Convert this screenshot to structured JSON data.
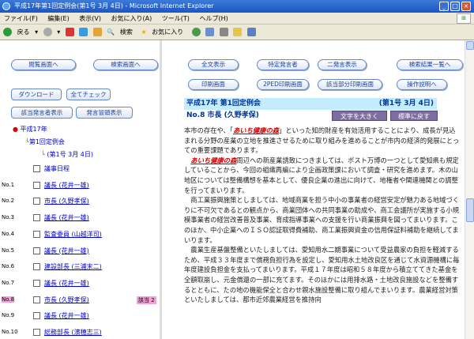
{
  "window": {
    "title": "平成17年第1回定例会(第1号 3月 4日) - Microsoft Internet Explorer"
  },
  "menu": [
    "ファイル(F)",
    "編集(E)",
    "表示(V)",
    "お気に入り(A)",
    "ツール(T)",
    "ヘルプ(H)"
  ],
  "toolbar": {
    "back": "戻る",
    "search": "検索",
    "favorites": "お気に入り"
  },
  "left": {
    "nav_buttons": [
      "閲覧画面へ",
      "検索画面へ"
    ],
    "action_buttons": [
      "ダウンロード",
      "全てチェック",
      "該当発言者表示",
      "発言冒頭表示"
    ],
    "tree": {
      "level1": "平成17年",
      "level2": "第1回定例会",
      "level3": "(第1号 3月 4日)"
    },
    "rows": [
      {
        "no": "",
        "label": "議事日程",
        "topic": ""
      },
      {
        "no": "No.1",
        "label": "議長 (花井一雄)",
        "topic": ""
      },
      {
        "no": "No.2",
        "label": "市長 (久野孝保)",
        "topic": ""
      },
      {
        "no": "No.3",
        "label": "議長 (花井一雄)",
        "topic": ""
      },
      {
        "no": "No.4",
        "label": "監査委員 (山越洋司)",
        "topic": ""
      },
      {
        "no": "No.5",
        "label": "議長 (花井一雄)",
        "topic": ""
      },
      {
        "no": "No.6",
        "label": "建設部長 (三浦末二)",
        "topic": ""
      },
      {
        "no": "No.7",
        "label": "議長 (花井一雄)",
        "topic": ""
      },
      {
        "no": "No.8",
        "label": "市長 (久野孝保)",
        "topic": "該当 2"
      },
      {
        "no": "No.9",
        "label": "議長 (花井一雄)",
        "topic": ""
      },
      {
        "no": "No.10",
        "label": "総務部長 (濱穂志三)",
        "topic": ""
      }
    ]
  },
  "right": {
    "buttons_row1": [
      "全文表示",
      "特定発言者",
      "二発言表示",
      "検索結果一覧へ"
    ],
    "buttons_row2": [
      "印刷画面",
      "2PED印刷画面",
      "該当部分印刷画面",
      "操作説明へ"
    ],
    "header_title": "平成17年 第1回定例会",
    "header_date": "(第1号 3月 4日)",
    "speaker": "No.8 市長 (久野孝保)",
    "font_large": "文字を大きく",
    "font_standard": "標準に戻す",
    "speech": [
      {
        "pre": "本市の存在や、「",
        "kw": "あいち健康の森",
        "post": "」といった知的財産を有効活用することにより、成長が見込まれる分野の産業の立地を推進させるために取り組みを進めることが市内の経済的発展にとっての重要課題であります。"
      },
      {
        "pre": "",
        "kw": "あいち健康の森",
        "post": "周辺への新産業誘致につきましては、ポスト万博の一つとして愛知県も規定していることから、今回の組織再編により企画政策課において調査・研究を進めます。木の山地区については整備構想を基本として、優良企業の進出に向けて、地権者や関連機関との調整を行ってまいります。"
      },
      {
        "pre": "",
        "kw": "",
        "post": "商工業振興施策としましては、地域商業を担う中小の事業者の経営安定が魅力ある地域づくりに不可欠であるとの観点から、商業団体への共同事業の助成や、商工会議所が実施する小規模事業者の経営改善普及事業、育成指導事業への支援を行い商業振興を図ってまいります。このほか、中小企業へのＩＳＯ認証取得費補助、商工業振興資金の信用保証料補助を継続してまいります。"
      },
      {
        "pre": "",
        "kw": "",
        "post": "農業生産基盤整備といたしましては、愛知用水二期事業について受益農家の負担を軽減するため、平成３３年度まで償務負担行為を設定し、愛知用水土地改良区を通じて水資源機構に毎年度建設負担金を支払ってまいります。平成１７年度は昭和５８年度から積立ててきた基金を全額取崩し、元金償還の一部に充てます。そのほかには用排水路・土地改良施設などを整備するとともに、たの地の機能保全と合わせ親水施設整備に取り組んでまいります。農業経営対策といたしましては、都市近郊農業経営を推持向"
      }
    ]
  }
}
